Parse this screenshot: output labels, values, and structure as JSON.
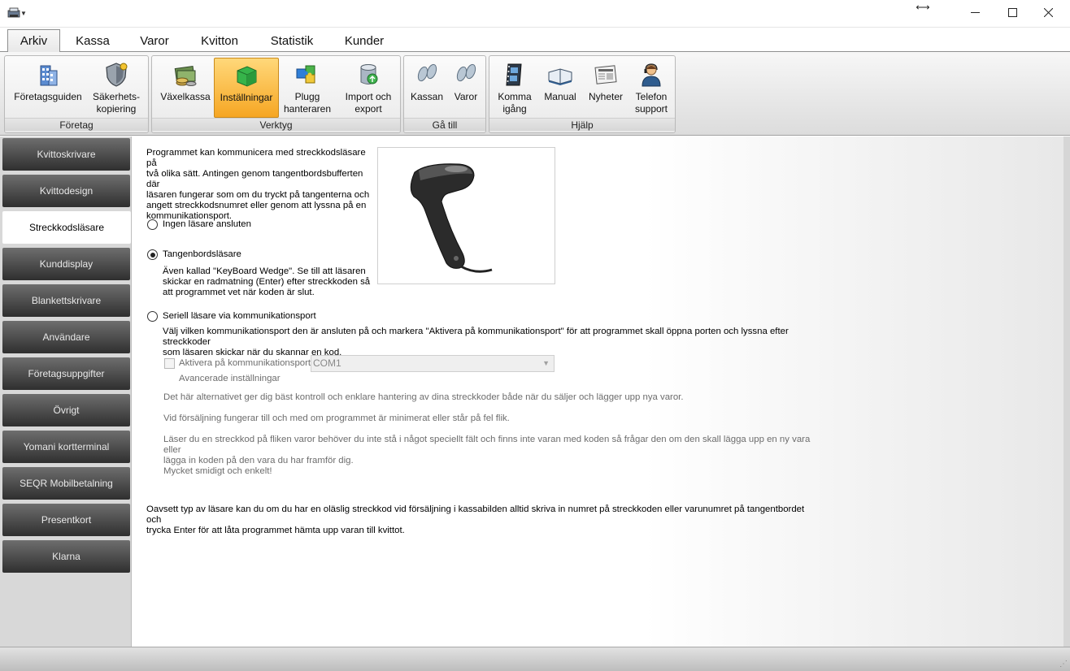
{
  "tabs": [
    {
      "label": "Arkiv"
    },
    {
      "label": "Kassa"
    },
    {
      "label": "Varor"
    },
    {
      "label": "Kvitton"
    },
    {
      "label": "Statistik"
    },
    {
      "label": "Kunder"
    }
  ],
  "ribbon": {
    "groups": {
      "foretag": {
        "label": "Företag",
        "buttons": [
          {
            "line1": "Företagsguiden",
            "line2": "",
            "icon": "building-icon"
          },
          {
            "line1": "Säkerhets-",
            "line2": "kopiering",
            "icon": "shield-icon"
          }
        ]
      },
      "verktyg": {
        "label": "Verktyg",
        "buttons": [
          {
            "line1": "Växelkassa",
            "line2": "",
            "icon": "cash-icon"
          },
          {
            "line1": "Inställningar",
            "line2": "",
            "icon": "settings-box-icon"
          },
          {
            "line1": "Plugg",
            "line2": "hanteraren",
            "icon": "puzzle-icon"
          },
          {
            "line1": "Import och",
            "line2": "export",
            "icon": "database-icon"
          }
        ]
      },
      "gatill": {
        "label": "Gå till",
        "buttons": [
          {
            "line1": "Kassan",
            "line2": "",
            "icon": "footprints-icon"
          },
          {
            "line1": "Varor",
            "line2": "",
            "icon": "footprints-icon"
          }
        ]
      },
      "hjalp": {
        "label": "Hjälp",
        "buttons": [
          {
            "line1": "Komma",
            "line2": "igång",
            "icon": "film-icon"
          },
          {
            "line1": "Manual",
            "line2": "",
            "icon": "book-icon"
          },
          {
            "line1": "Nyheter",
            "line2": "",
            "icon": "newspaper-icon"
          },
          {
            "line1": "Telefon",
            "line2": "support",
            "icon": "support-person-icon"
          }
        ]
      }
    }
  },
  "sidebar": {
    "items": [
      {
        "label": "Kvittoskrivare"
      },
      {
        "label": "Kvittodesign"
      },
      {
        "label": "Streckkodsläsare"
      },
      {
        "label": "Kunddisplay"
      },
      {
        "label": "Blankettskrivare"
      },
      {
        "label": "Användare"
      },
      {
        "label": "Företagsuppgifter"
      },
      {
        "label": "Övrigt"
      },
      {
        "label": "Yomani kortterminal"
      },
      {
        "label": "SEQR Mobilbetalning"
      },
      {
        "label": "Presentkort"
      },
      {
        "label": "Klarna"
      }
    ]
  },
  "content": {
    "intro": [
      "Programmet kan kommunicera med streckkodsläsare på",
      "två olika sätt. Antingen genom tangentbordsbufferten där",
      "läsaren fungerar som om du tryckt på tangenterna och",
      "angett streckkodsnumret eller genom att lyssna på en",
      "kommunikationsport."
    ],
    "option_none": "Ingen läsare ansluten",
    "option_keyboard": "Tangenbordsläsare",
    "keyboard_desc": [
      "Även kallad \"KeyBoard Wedge\". Se till att läsaren",
      "skickar en radmatning (Enter) efter streckkoden så",
      "att programmet vet när koden är slut."
    ],
    "option_serial": "Seriell läsare via kommunikationsport",
    "serial_desc": [
      "Välj vilken kommunikationsport den är ansluten på och markera \"Aktivera på kommunikationsport\" för att programmet skall öppna porten och lyssna efter streckkoder",
      "som läsaren skickar när du skannar en kod."
    ],
    "activate_label": "Aktivera på kommunikationsport:",
    "com_port": "COM1",
    "advanced": "Avancerade inställningar",
    "info1": "Det här alternativet ger dig bäst kontroll och enklare hantering av dina streckkoder både när du säljer och lägger upp nya varor.",
    "info2": "Vid försäljning fungerar till och med om programmet är minimerat eller står på fel flik.",
    "info3": [
      "Läser du en streckkod på fliken varor behöver du inte stå i något speciellt fält och finns inte varan med koden så frågar den om den skall lägga upp en ny vara eller",
      "lägga in koden på den vara du har framför dig."
    ],
    "info4": "Mycket smidigt och enkelt!",
    "footer": [
      "Oavsett typ av läsare kan du om du har en oläslig streckkod vid försäljning i kassabilden alltid skriva in numret på streckkoden eller varunumret på tangentbordet och",
      "trycka Enter för att låta programmet hämta upp varan till kvittot."
    ]
  }
}
